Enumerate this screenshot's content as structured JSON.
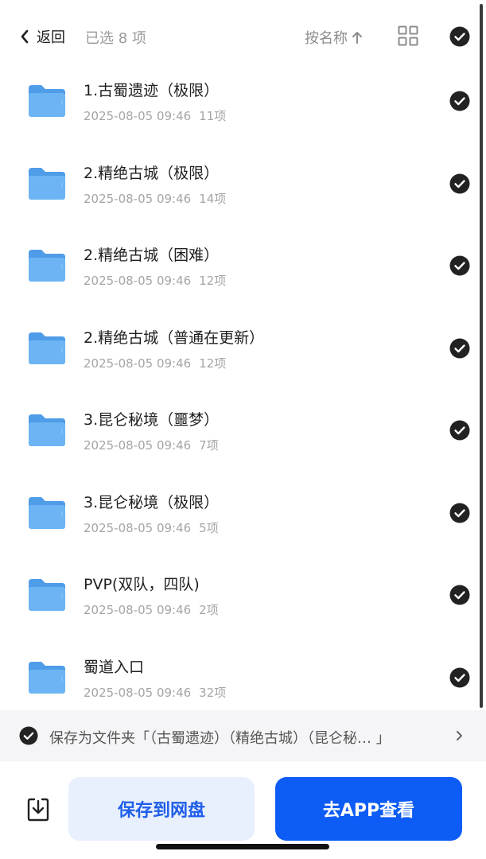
{
  "header": {
    "back_label": "返回",
    "selected_text": "已选 8 项",
    "sort_label": "按名称"
  },
  "items": [
    {
      "name": "1.古蜀遗迹（极限）",
      "date": "2025-08-05 09:46",
      "count": "11项"
    },
    {
      "name": "2.精绝古城（极限）",
      "date": "2025-08-05 09:46",
      "count": "14项"
    },
    {
      "name": "2.精绝古城（困难）",
      "date": "2025-08-05 09:46",
      "count": "12项"
    },
    {
      "name": "2.精绝古城（普通在更新）",
      "date": "2025-08-05 09:46",
      "count": "12项"
    },
    {
      "name": "3.昆仑秘境（噩梦）",
      "date": "2025-08-05 09:46",
      "count": "7项"
    },
    {
      "name": "3.昆仑秘境（极限）",
      "date": "2025-08-05 09:46",
      "count": "5项"
    },
    {
      "name": "PVP(双队，四队)",
      "date": "2025-08-05 09:46",
      "count": "2项"
    },
    {
      "name": "蜀道入口",
      "date": "2025-08-05 09:46",
      "count": "32项"
    }
  ],
  "save_bar": {
    "text": "保存为文件夹「（古蜀遗迹）（精绝古城）（昆仑秘… 」"
  },
  "bottom": {
    "save_button": "保存到网盘",
    "app_button": "去APP查看"
  },
  "colors": {
    "folder": "#5aaaf0",
    "primary": "#0d5cf5",
    "primary_light": "#e8effd",
    "check": "#222222"
  }
}
